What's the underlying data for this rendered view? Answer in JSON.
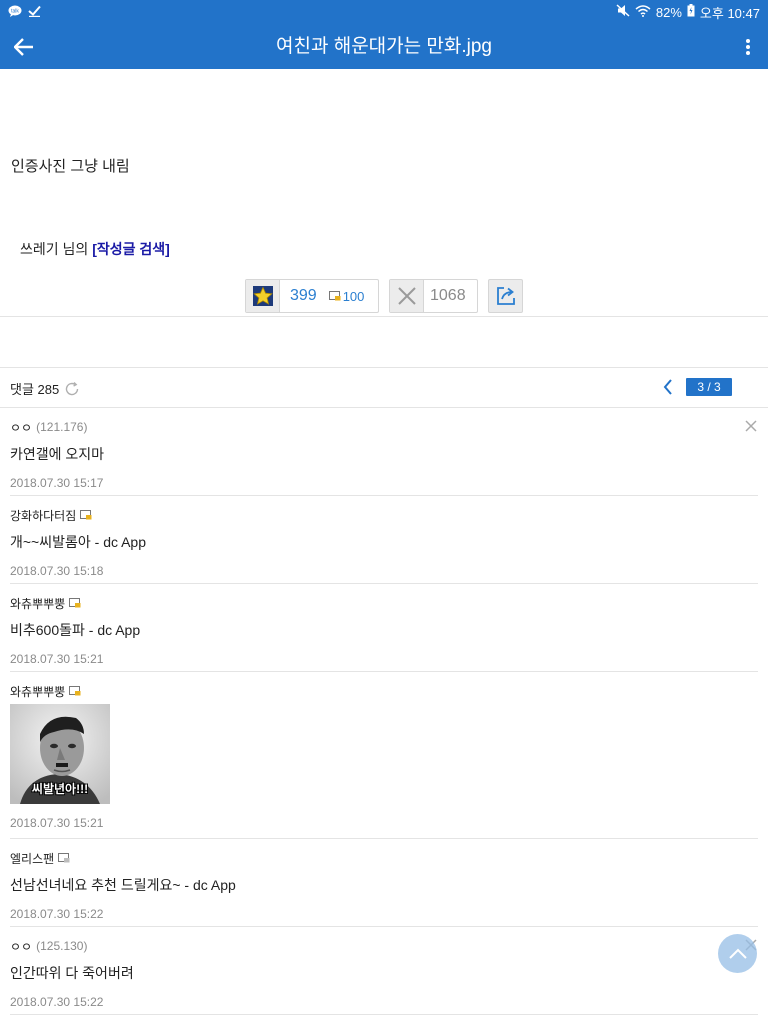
{
  "status_bar": {
    "battery": "82%",
    "time": "오후 10:47",
    "icons": [
      "chat-bubble-icon",
      "check-icon",
      "mute-icon",
      "wifi-icon",
      "battery-icon"
    ]
  },
  "app_bar": {
    "title": "여친과 해운대가는 만화.jpg"
  },
  "post": {
    "body": "인증사진 그냥 내림",
    "author_prefix": "쓰레기 님의 ",
    "author_search": "[작성글 검색]"
  },
  "votes": {
    "up_count": "399",
    "fixed_count": "100",
    "down_count": "1068"
  },
  "comments_header": {
    "label": "댓글 285",
    "page": "3 / 3"
  },
  "comments": [
    {
      "author": "ㅇㅇ",
      "ip": "(121.176)",
      "text": "카연갤에 오지마",
      "date": "2018.07.30 15:17"
    },
    {
      "author": "강화하다터짐",
      "text": "개~~씨발롬아 - dc App",
      "date": "2018.07.30 15:18"
    },
    {
      "author": "와츄뿌뿌뿡",
      "text": "비추600돌파 - dc App",
      "date": "2018.07.30 15:21"
    },
    {
      "author": "와츄뿌뿌뿡",
      "image_caption": "씨발년아!!!",
      "date": "2018.07.30 15:21"
    },
    {
      "author": "엘리스팬",
      "text": "선남선녀네요 추천 드릴게요~ - dc App",
      "date": "2018.07.30 15:22"
    },
    {
      "author": "ㅇㅇ",
      "ip": "(125.130)",
      "text": "인간따위 다 죽어버려",
      "date": "2018.07.30 15:22"
    }
  ],
  "colors": {
    "header_blue": "#2273c9",
    "link_blue": "#1a1aa6",
    "count_blue": "#2b7fd0"
  }
}
